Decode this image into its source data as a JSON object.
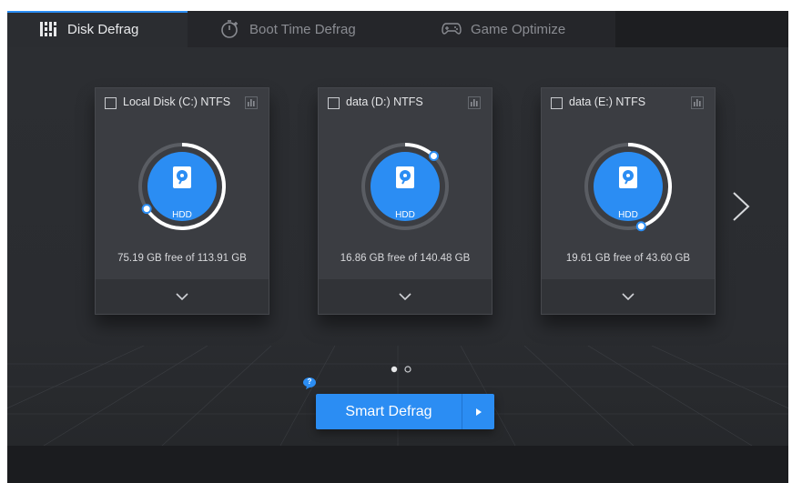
{
  "tabs": [
    {
      "label": "Disk Defrag",
      "active": true,
      "icon": "disk-defrag-icon"
    },
    {
      "label": "Boot Time Defrag",
      "active": false,
      "icon": "stopwatch-icon"
    },
    {
      "label": "Game Optimize",
      "active": false,
      "icon": "gamepad-icon"
    }
  ],
  "disks": [
    {
      "title": "Local Disk (C:) NTFS",
      "type_label": "HDD",
      "free_text": "75.19 GB free of 113.91 GB",
      "free_gb": 75.19,
      "total_gb": 113.91,
      "checked": false
    },
    {
      "title": "data (D:) NTFS",
      "type_label": "HDD",
      "free_text": "16.86 GB free of 140.48 GB",
      "free_gb": 16.86,
      "total_gb": 140.48,
      "checked": false
    },
    {
      "title": "data (E:) NTFS",
      "type_label": "HDD",
      "free_text": "19.61 GB free of 43.60 GB",
      "free_gb": 19.61,
      "total_gb": 43.6,
      "checked": false
    }
  ],
  "pagination": {
    "pages": 2,
    "current": 1
  },
  "help": {
    "label": "?"
  },
  "action": {
    "label": "Smart Defrag"
  },
  "colors": {
    "accent": "#2b8df3",
    "background": "#2b2d31",
    "card": "#3b3d42"
  }
}
